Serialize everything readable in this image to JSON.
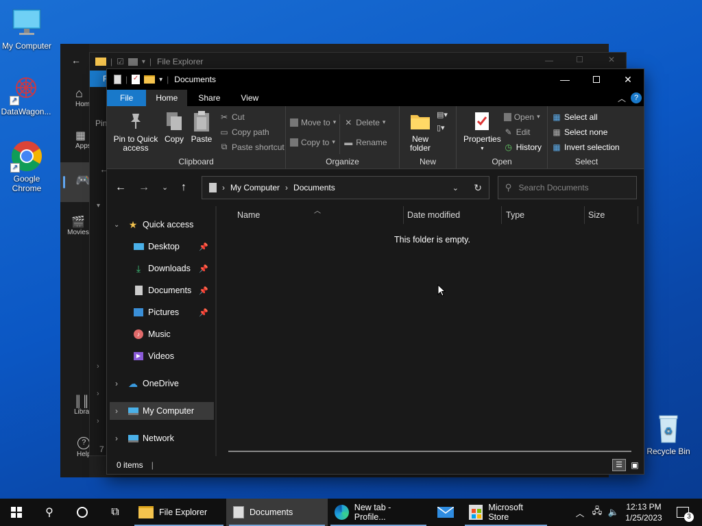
{
  "desktop": {
    "icons": [
      {
        "label": "My Computer"
      },
      {
        "label": "DataWagon..."
      },
      {
        "label": "Google Chrome"
      },
      {
        "label": "Recycle Bin"
      }
    ]
  },
  "bg_window": {
    "title": "File Explorer",
    "tab_file": "Fi",
    "sidebar": [
      {
        "label": "Home"
      },
      {
        "label": "Apps"
      },
      {
        "label": "Movies"
      },
      {
        "label": "Libra"
      },
      {
        "label": "Help"
      }
    ],
    "pin_label": "Pin",
    "status": "7 i"
  },
  "window": {
    "title": "Documents",
    "tabs": {
      "file": "File",
      "home": "Home",
      "share": "Share",
      "view": "View"
    },
    "ribbon": {
      "clipboard": {
        "label": "Clipboard",
        "pin": "Pin to Quick access",
        "copy": "Copy",
        "paste": "Paste",
        "cut": "Cut",
        "copy_path": "Copy path",
        "paste_shortcut": "Paste shortcut"
      },
      "organize": {
        "label": "Organize",
        "move_to": "Move to",
        "copy_to": "Copy to",
        "delete": "Delete",
        "rename": "Rename"
      },
      "new": {
        "label": "New",
        "new_folder": "New folder"
      },
      "open": {
        "label": "Open",
        "properties": "Properties",
        "open": "Open",
        "edit": "Edit",
        "history": "History"
      },
      "select": {
        "label": "Select",
        "select_all": "Select all",
        "select_none": "Select none",
        "invert": "Invert selection"
      }
    },
    "address": {
      "crumbs": [
        "My Computer",
        "Documents"
      ]
    },
    "search": {
      "placeholder": "Search Documents"
    },
    "nav": {
      "quick_access": "Quick access",
      "items": [
        {
          "label": "Desktop"
        },
        {
          "label": "Downloads"
        },
        {
          "label": "Documents"
        },
        {
          "label": "Pictures"
        },
        {
          "label": "Music"
        },
        {
          "label": "Videos"
        }
      ],
      "onedrive": "OneDrive",
      "my_computer": "My Computer",
      "network": "Network"
    },
    "columns": {
      "name": "Name",
      "date": "Date modified",
      "type": "Type",
      "size": "Size"
    },
    "empty_message": "This folder is empty.",
    "status": "0 items"
  },
  "taskbar": {
    "apps": [
      {
        "label": "File Explorer"
      },
      {
        "label": "Documents"
      },
      {
        "label": "New tab - Profile..."
      },
      {
        "label": "Microsoft Store"
      }
    ],
    "time": "12:13 PM",
    "date": "1/25/2023",
    "notifications": "3"
  }
}
